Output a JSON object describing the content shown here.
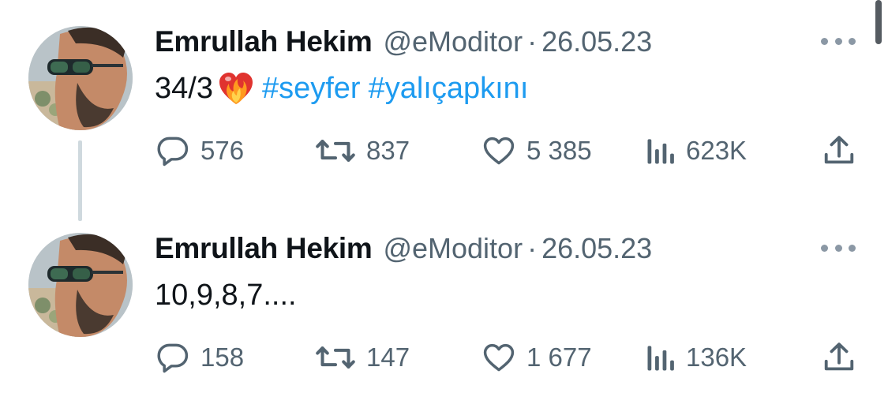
{
  "thread": [
    {
      "author": {
        "name": "Emrullah Hekim",
        "handle": "@eModitor",
        "separator": "·",
        "date": "26.05.23"
      },
      "text_main": "34/3",
      "emoji": "heart-on-fire",
      "hashtags": [
        "#seyfer",
        "#yalıçapkını"
      ],
      "stats": {
        "replies": "576",
        "retweets": "837",
        "likes": "5 385",
        "views": "623K"
      }
    },
    {
      "author": {
        "name": "Emrullah Hekim",
        "handle": "@eModitor",
        "separator": "·",
        "date": "26.05.23"
      },
      "text_main": "10,9,8,7....",
      "stats": {
        "replies": "158",
        "retweets": "147",
        "likes": "1 677",
        "views": "136K"
      }
    }
  ],
  "icons": {
    "reply": "reply-icon",
    "retweet": "retweet-icon",
    "like": "heart-icon",
    "views": "views-bar-chart-icon",
    "share": "share-upload-icon",
    "more": "more-dots-icon"
  },
  "colors": {
    "text": "#0f1419",
    "muted": "#536471",
    "hashtag": "#1d9bf0",
    "thread_line": "#cfd9de"
  }
}
